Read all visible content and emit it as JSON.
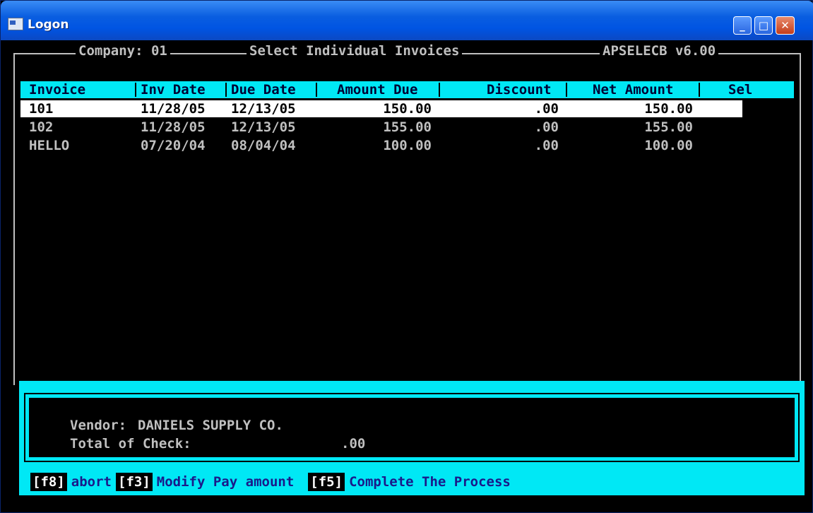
{
  "window": {
    "title": "Logon",
    "buttons": [
      "minimize",
      "maximize",
      "close"
    ]
  },
  "header": {
    "company": "Company: 01",
    "screen_title": "Select Individual Invoices",
    "program": "APSELECB v6.00"
  },
  "columns": [
    "Invoice",
    "Inv Date",
    "Due Date",
    "Amount Due",
    "Discount",
    "Net Amount",
    "Sel"
  ],
  "rows": [
    {
      "invoice": "101",
      "inv_date": "11/28/05",
      "due_date": "12/13/05",
      "amount_due": "150.00",
      "discount": ".00",
      "net_amount": "150.00",
      "sel": ""
    },
    {
      "invoice": "102",
      "inv_date": "11/28/05",
      "due_date": "12/13/05",
      "amount_due": "155.00",
      "discount": ".00",
      "net_amount": "155.00",
      "sel": ""
    },
    {
      "invoice": "HELLO",
      "inv_date": "07/20/04",
      "due_date": "08/04/04",
      "amount_due": "100.00",
      "discount": ".00",
      "net_amount": "100.00",
      "sel": ""
    }
  ],
  "summary": {
    "vendor_label": "Vendor:",
    "vendor_name": "DANIELS SUPPLY CO.",
    "total_label": "Total of Check:",
    "total_value": ".00"
  },
  "function_keys": [
    {
      "key": "f8",
      "label": "abort"
    },
    {
      "key": "f3",
      "label": "Modify Pay amount"
    },
    {
      "key": "f5",
      "label": "Complete The Process"
    }
  ],
  "colors": {
    "title_bar": "#0054e3",
    "cyan": "#00e8f5",
    "screen_bg": "#000000",
    "text": "#c0c0c0"
  }
}
